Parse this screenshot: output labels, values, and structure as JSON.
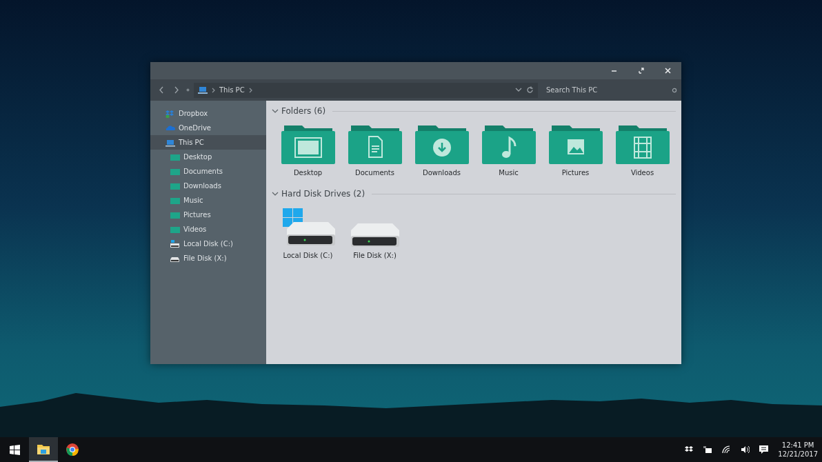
{
  "window": {
    "controls": [
      {
        "kind": "minimize"
      },
      {
        "kind": "restore"
      },
      {
        "kind": "close"
      }
    ],
    "address": {
      "crumbs": [
        "This PC"
      ]
    },
    "search": {
      "placeholder": "Search This PC"
    }
  },
  "sidebar": {
    "items": [
      {
        "label": "Dropbox",
        "kind": "dropbox",
        "selected": false
      },
      {
        "label": "OneDrive",
        "kind": "onedrive",
        "selected": false
      },
      {
        "label": "This PC",
        "kind": "pc",
        "selected": true,
        "children": [
          {
            "label": "Desktop",
            "kind": "folder",
            "selected": false
          },
          {
            "label": "Documents",
            "kind": "folder",
            "selected": false
          },
          {
            "label": "Downloads",
            "kind": "folder",
            "selected": false
          },
          {
            "label": "Music",
            "kind": "folder",
            "selected": false
          },
          {
            "label": "Pictures",
            "kind": "folder",
            "selected": false
          },
          {
            "label": "Videos",
            "kind": "folder",
            "selected": false
          },
          {
            "label": "Local Disk (C:)",
            "kind": "system-drive",
            "selected": false
          },
          {
            "label": "File Disk (X:)",
            "kind": "drive",
            "selected": false
          }
        ]
      }
    ]
  },
  "groups": [
    {
      "title": "Folders (6)",
      "expanded": true,
      "items": [
        {
          "label": "Desktop",
          "kind": "desktop"
        },
        {
          "label": "Documents",
          "kind": "documents"
        },
        {
          "label": "Downloads",
          "kind": "downloads"
        },
        {
          "label": "Music",
          "kind": "music"
        },
        {
          "label": "Pictures",
          "kind": "pictures"
        },
        {
          "label": "Videos",
          "kind": "videos"
        }
      ]
    },
    {
      "title": "Hard Disk Drives (2)",
      "expanded": true,
      "items": [
        {
          "label": "Local Disk (C:)",
          "kind": "system-drive"
        },
        {
          "label": "File Disk (X:)",
          "kind": "drive"
        }
      ]
    }
  ],
  "taskbar": {
    "apps": [
      {
        "kind": "explorer",
        "selected": true
      },
      {
        "kind": "chrome",
        "selected": false
      }
    ],
    "tray": [
      {
        "kind": "dropbox"
      },
      {
        "kind": "power"
      },
      {
        "kind": "wifi"
      },
      {
        "kind": "volume"
      },
      {
        "kind": "notifications"
      }
    ],
    "clock": {
      "time": "12:41 PM",
      "date": "12/21/2017"
    }
  }
}
